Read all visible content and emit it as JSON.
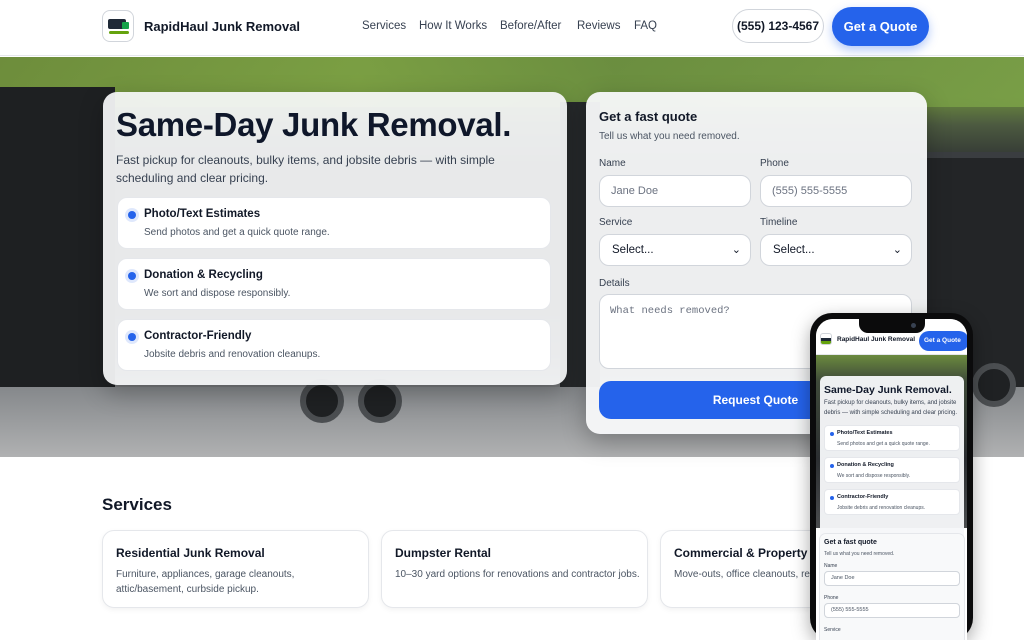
{
  "header": {
    "brand": "RapidHaul Junk Removal",
    "nav": [
      "Services",
      "How It Works",
      "Before/After",
      "Reviews",
      "FAQ"
    ],
    "phone": "(555) 123-4567",
    "cta": "Get a Quote"
  },
  "hero": {
    "title": "Same-Day Junk Removal.",
    "subtitle": "Fast pickup for cleanouts, bulky items, and jobsite debris — with simple scheduling and clear pricing.",
    "features": [
      {
        "title": "Photo/Text Estimates",
        "desc": "Send photos and get a quick quote range."
      },
      {
        "title": "Donation & Recycling",
        "desc": "We sort and dispose responsibly."
      },
      {
        "title": "Contractor-Friendly",
        "desc": "Jobsite debris and renovation cleanups."
      }
    ]
  },
  "quote_form": {
    "title": "Get a fast quote",
    "subtitle": "Tell us what you need removed.",
    "name_label": "Name",
    "name_placeholder": "Jane Doe",
    "phone_label": "Phone",
    "phone_placeholder": "(555) 555-5555",
    "service_label": "Service",
    "service_value": "Select...",
    "timeline_label": "Timeline",
    "timeline_value": "Select...",
    "details_label": "Details",
    "details_placeholder": "What needs removed?",
    "submit": "Request Quote"
  },
  "services": {
    "title": "Services",
    "items": [
      {
        "title": "Residential Junk Removal",
        "desc": "Furniture, appliances, garage cleanouts, attic/basement, curbside pickup."
      },
      {
        "title": "Dumpster Rental",
        "desc": "10–30 yard options for renovations and contractor jobs."
      },
      {
        "title": "Commercial & Property M",
        "desc": "Move-outs, office cleanouts, re hauling."
      }
    ]
  },
  "mobile": {
    "brand": "RapidHaul Junk Removal",
    "cta": "Get a Quote",
    "title": "Same-Day Junk Removal.",
    "subtitle": "Fast pickup for cleanouts, bulky items, and jobsite debris — with simple scheduling and clear pricing.",
    "features": [
      {
        "title": "Photo/Text Estimates",
        "desc": "Send photos and get a quick quote range."
      },
      {
        "title": "Donation & Recycling",
        "desc": "We sort and dispose responsibly."
      },
      {
        "title": "Contractor-Friendly",
        "desc": "Jobsite debris and renovation cleanups."
      }
    ],
    "form_title": "Get a fast quote",
    "form_subtitle": "Tell us what you need removed.",
    "name_label": "Name",
    "name_value": "Jane Doe",
    "phone_label": "Phone",
    "phone_value": "(555) 555-5555",
    "service_label": "Service"
  },
  "colors": {
    "accent": "#2563eb",
    "text": "#0f172a",
    "bullet": "#2563eb"
  },
  "icons": {
    "logo": "truck-logo-icon",
    "select_chevron": "chevron-down-icon",
    "bullet": "bullet-dot-icon"
  }
}
